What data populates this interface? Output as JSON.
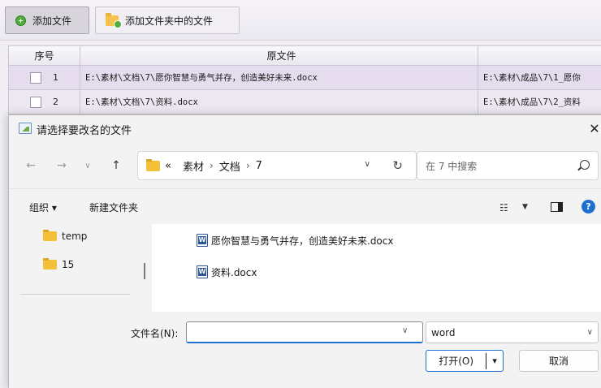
{
  "toolbar": {
    "add_file_label": "添加文件",
    "add_folder_files_label": "添加文件夹中的文件"
  },
  "grid": {
    "columns": {
      "no": "序号",
      "source": "原文件"
    },
    "rows": [
      {
        "no": "1",
        "source": "E:\\素材\\文档\\7\\愿你智慧与勇气并存，创造美好未来.docx",
        "target": "E:\\素材\\成品\\7\\1_愿你"
      },
      {
        "no": "2",
        "source": "E:\\素材\\文档\\7\\资料.docx",
        "target": "E:\\素材\\成品\\7\\2_资料"
      }
    ]
  },
  "dialog": {
    "title": "请选择要改名的文件",
    "close_glyph": "✕",
    "nav": {
      "back_glyph": "←",
      "forward_glyph": "→",
      "recent_glyph": "∨",
      "up_glyph": "↑",
      "breadcrumb_prefix": "«",
      "breadcrumb": [
        "素材",
        "文档",
        "7"
      ],
      "breadcrumb_sep": "›",
      "dropdown_glyph": "∨",
      "refresh_glyph": "↻",
      "search_placeholder": "在 7 中搜索"
    },
    "commands": {
      "organize": "组织 ▾",
      "new_folder": "新建文件夹",
      "view_glyph": "☷",
      "view_dropdown_glyph": "▼",
      "help_glyph": "?"
    },
    "tree": [
      {
        "label": "temp"
      },
      {
        "label": "15"
      }
    ],
    "files": [
      {
        "name": "愿你智慧与勇气并存，创造美好未来.docx"
      },
      {
        "name": "资料.docx"
      }
    ],
    "filename_label": "文件名(N):",
    "filename_value": "",
    "filename_dd_glyph": "∨",
    "filetype_value": "word",
    "filetype_dd_glyph": "∨",
    "open_label": "打开(O)",
    "open_dd_glyph": "▾",
    "cancel_label": "取消"
  },
  "colors": {
    "accent": "#1f6fd1",
    "folder": "#f3c038",
    "selected_row": "#e5dced"
  }
}
